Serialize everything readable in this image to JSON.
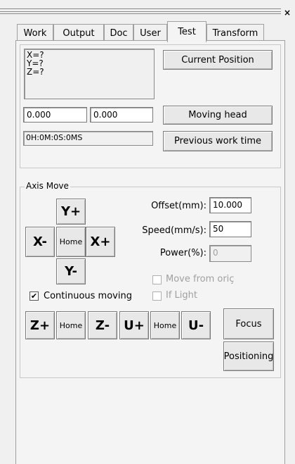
{
  "window": {
    "close_glyph": "×"
  },
  "tabs": [
    "Work",
    "Output",
    "Doc",
    "User",
    "Test",
    "Transform"
  ],
  "active_tab": "Test",
  "position": {
    "readout_lines": [
      "X=?",
      "Y=?",
      "Z=?"
    ],
    "current_position_label": "Current Position",
    "head_x_value": "0.000",
    "head_y_value": "0.000",
    "moving_head_label": "Moving head",
    "work_time_value": "0H:0M:0S:0MS",
    "previous_work_time_label": "Previous work time"
  },
  "axis_move": {
    "title": "Axis Move",
    "y_plus": "Y+",
    "y_minus": "Y-",
    "x_plus": "X+",
    "x_minus": "X-",
    "home": "Home",
    "z_plus": "Z+",
    "z_minus": "Z-",
    "u_plus": "U+",
    "u_minus": "U-",
    "offset_label": "Offset(mm):",
    "offset_value": "10.000",
    "speed_label": "Speed(mm/s):",
    "speed_value": "50",
    "power_label": "Power(%):",
    "power_value": "0",
    "move_from_origin_label": "Move from oriç",
    "if_light_label": "If Light",
    "continuous_moving_label": "Continuous moving",
    "continuous_moving_checked": true,
    "check_glyph": "✔",
    "focus_label": "Focus",
    "positioning_label": "Positioning"
  }
}
